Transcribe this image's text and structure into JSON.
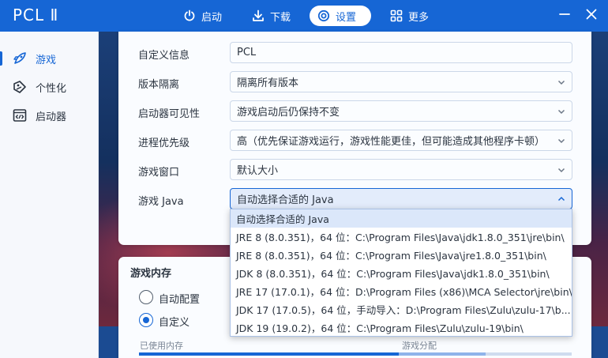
{
  "app": {
    "title": "PCL Ⅱ"
  },
  "nav": [
    {
      "label": "启动",
      "icon": "power-icon"
    },
    {
      "label": "下载",
      "icon": "download-icon"
    },
    {
      "label": "设置",
      "icon": "settings-icon"
    },
    {
      "label": "更多",
      "icon": "grid-icon"
    }
  ],
  "active_nav": "设置",
  "window": {
    "minimize_icon": "minimize-icon",
    "close_icon": "close-icon"
  },
  "sidebar": {
    "items": [
      {
        "label": "游戏",
        "icon": "rocket-icon",
        "active": true
      },
      {
        "label": "个性化",
        "icon": "palette-icon",
        "active": false
      },
      {
        "label": "启动器",
        "icon": "code-window-icon",
        "active": false
      }
    ]
  },
  "launch_settings": {
    "fields": [
      {
        "label": "自定义信息",
        "value": "PCL",
        "type": "text"
      },
      {
        "label": "版本隔离",
        "value": "隔离所有版本",
        "type": "select"
      },
      {
        "label": "启动器可见性",
        "value": "游戏启动后仍保持不变",
        "type": "select"
      },
      {
        "label": "进程优先级",
        "value": "高（优先保证游戏运行，游戏性能更佳，但可能造成其他程序卡顿）",
        "type": "select"
      },
      {
        "label": "游戏窗口",
        "value": "默认大小",
        "type": "select"
      },
      {
        "label": "游戏 Java",
        "value": "自动选择合适的 Java",
        "type": "select-open"
      }
    ],
    "java_options": [
      "自动选择合适的 Java",
      "JRE 8 (8.0.351)，64 位：C:\\Program Files\\Java\\jdk1.8.0_351\\jre\\bin\\",
      "JRE 8 (8.0.351)，64 位：C:\\Program Files\\Java\\jre1.8.0_351\\bin\\",
      "JDK 8 (8.0.351)，64 位：C:\\Program Files\\Java\\jdk1.8.0_351\\bin\\",
      "JRE 17 (17.0.1)，64 位：D:\\Program Files (x86)\\MCA Selector\\jre\\bin\\",
      "JDK 17 (17.0.5)，64 位，手动导入：D:\\Program Files\\Zulu\\zulu-17\\b...",
      "JDK 19 (19.0.2)，64 位：C:\\Program Files\\Zulu\\zulu-19\\bin\\"
    ],
    "java_selected_index": 0
  },
  "memory": {
    "title": "游戏内存",
    "options": [
      {
        "label": "自动配置",
        "checked": false
      },
      {
        "label": "自定义",
        "checked": true
      }
    ],
    "used_label": "已使用内存",
    "alloc_label": "游戏分配",
    "used_fraction": 0.6,
    "alloc_fraction": 0.2
  },
  "colors": {
    "accent": "#1666d5",
    "titlebar": "#1666d5"
  }
}
